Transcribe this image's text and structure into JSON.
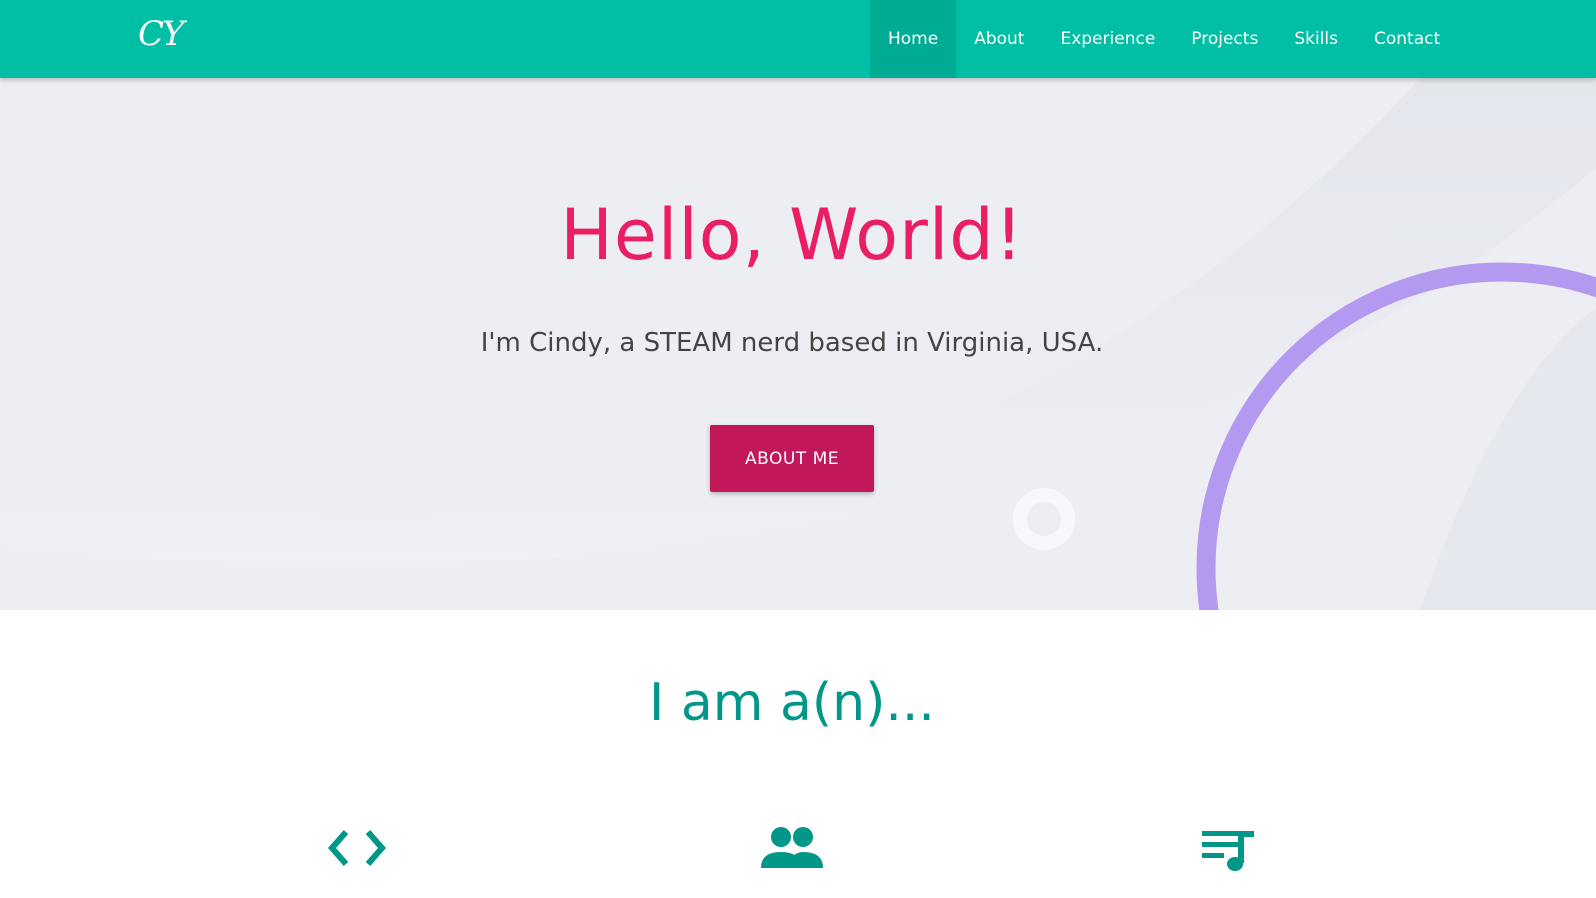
{
  "navbar": {
    "logo_text": "CY",
    "items": [
      {
        "label": "Home",
        "active": true
      },
      {
        "label": "About"
      },
      {
        "label": "Experience"
      },
      {
        "label": "Projects"
      },
      {
        "label": "Skills"
      },
      {
        "label": "Contact"
      }
    ],
    "color": "#00bfa5"
  },
  "hero": {
    "title": "Hello, World!",
    "subtitle": "I'm Cindy, a STEAM nerd based in Virginia, USA.",
    "button_label": "ABOUT ME",
    "title_color": "#e91e63",
    "button_color": "#c2185b",
    "ring_color": "#b39af0"
  },
  "roles": {
    "title": "I am a(n)...",
    "title_color": "#009688",
    "icons": [
      "code-icon",
      "people-icon",
      "playlist-music-icon"
    ]
  }
}
